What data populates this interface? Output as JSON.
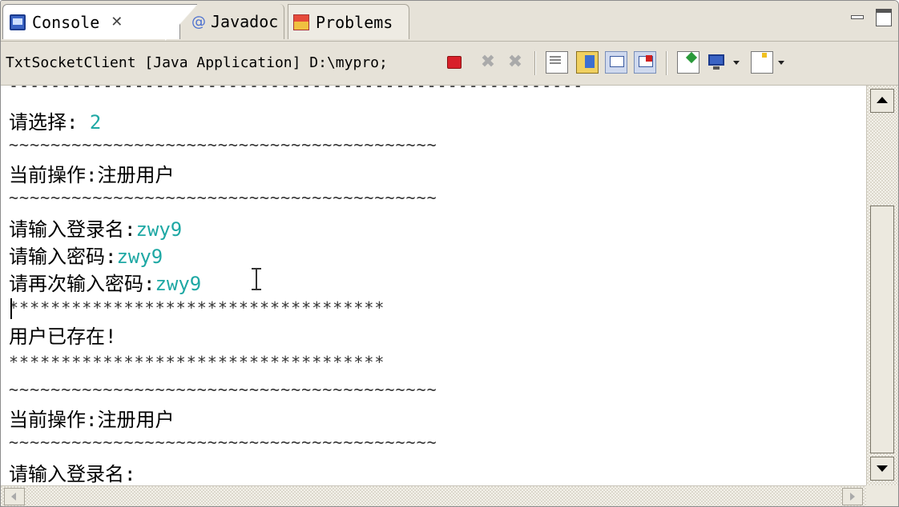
{
  "tabs": [
    {
      "label": "Console",
      "close": "✕"
    },
    {
      "label": "Javadoc",
      "icon_glyph": "@"
    },
    {
      "label": "Problems"
    }
  ],
  "toolbar": {
    "launch_label": "TxtSocketClient [Java Application] D:\\mypro;"
  },
  "console": {
    "lines": [
      {
        "text": "-------------------------------------------------------"
      },
      {
        "prompt": "请选择: ",
        "input": "2"
      },
      {
        "text": "~~~~~~~~~~~~~~~~~~~~~~~~~~~~~~~~~~~~~~~~~"
      },
      {
        "text": "当前操作:注册用户"
      },
      {
        "text": "~~~~~~~~~~~~~~~~~~~~~~~~~~~~~~~~~~~~~~~~~"
      },
      {
        "prompt": "请输入登录名:",
        "input": "zwy9"
      },
      {
        "prompt": "请输入密码:",
        "input": "zwy9"
      },
      {
        "prompt": "请再次输入密码:",
        "input": "zwy9"
      },
      {
        "text": "************************************"
      },
      {
        "text": "用户已存在!"
      },
      {
        "text": "************************************"
      },
      {
        "text": "~~~~~~~~~~~~~~~~~~~~~~~~~~~~~~~~~~~~~~~~~"
      },
      {
        "text": "当前操作:注册用户"
      },
      {
        "text": "~~~~~~~~~~~~~~~~~~~~~~~~~~~~~~~~~~~~~~~~~"
      },
      {
        "prompt": "请输入登录名:"
      }
    ]
  },
  "colors": {
    "input_text": "#1ea8a4",
    "chrome_bg": "#e6e2d8",
    "terminate_red": "#d8202a"
  },
  "icons": {
    "console": "console-icon",
    "javadoc": "at-icon",
    "problems": "problems-icon",
    "terminate": "terminate-icon",
    "remove_launch": "remove-launch-icon",
    "remove_all": "remove-all-terminated-icon",
    "clear": "clear-console-icon",
    "scroll_lock": "scroll-lock-icon",
    "show_on_out": "show-on-stdout-icon",
    "show_on_err": "show-on-stderr-icon",
    "pin": "pin-console-icon",
    "display": "display-selected-console-icon",
    "open": "open-console-icon"
  }
}
